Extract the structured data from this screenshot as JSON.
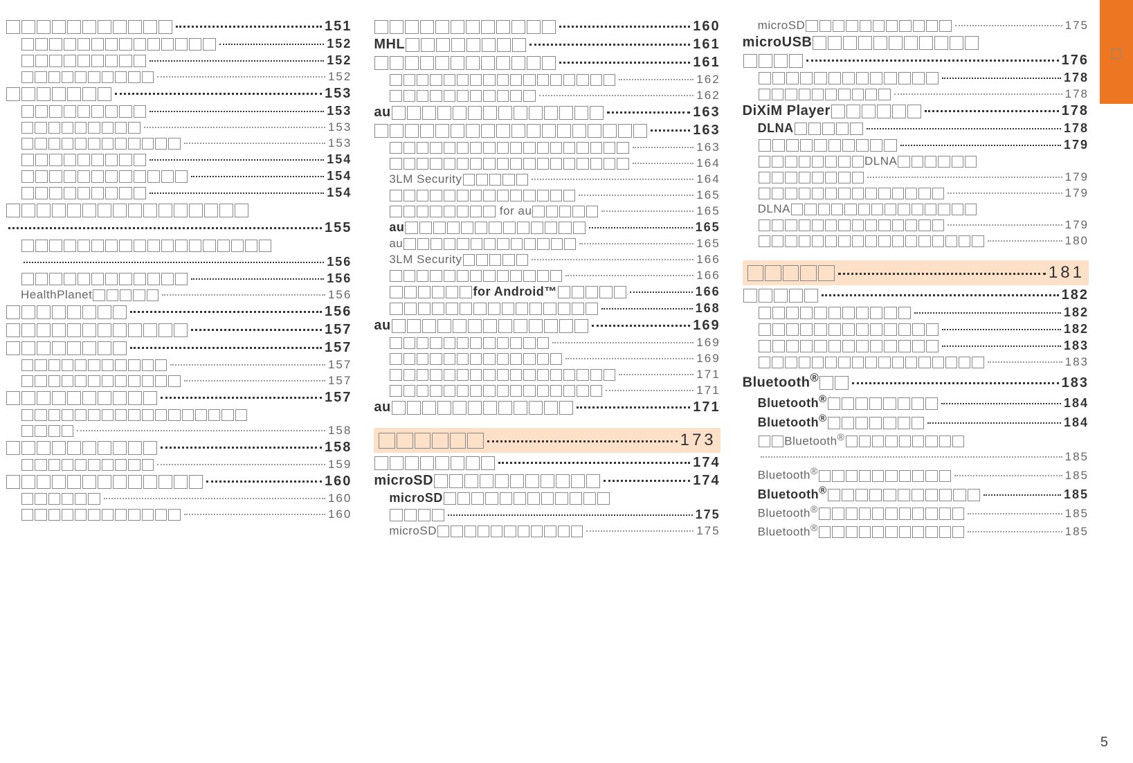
{
  "page_number": "5",
  "side_tab_text": "⬜",
  "columns": [
    [
      {
        "level": 0,
        "boxes": 11,
        "text": "",
        "page": "151"
      },
      {
        "level": 1,
        "boxes": 14,
        "text": "",
        "page": "152"
      },
      {
        "level": 1,
        "boxes": 9,
        "text": "",
        "page": "152"
      },
      {
        "level": 2,
        "boxes": 10,
        "text": "",
        "page": "152"
      },
      {
        "level": 0,
        "boxes": 7,
        "text": "",
        "page": "153"
      },
      {
        "level": 1,
        "boxes": 9,
        "text": "",
        "page": "153"
      },
      {
        "level": 2,
        "boxes": 9,
        "text": "",
        "page": "153"
      },
      {
        "level": 2,
        "boxes": 12,
        "text": "",
        "page": "153"
      },
      {
        "level": 1,
        "boxes": 9,
        "text": "",
        "page": "154"
      },
      {
        "level": 1,
        "boxes": 12,
        "text": "",
        "page": "154"
      },
      {
        "level": 1,
        "boxes": 9,
        "text": "",
        "page": "154"
      },
      {
        "level": 0,
        "nodots": true,
        "boxes": 16,
        "text": "",
        "page": ""
      },
      {
        "level": 0,
        "boxes": 0,
        "text": "",
        "page": "155",
        "prefix_dots_only": true
      },
      {
        "level": 1,
        "nodots": true,
        "boxes": 18,
        "text": "",
        "page": ""
      },
      {
        "level": 1,
        "boxes": 0,
        "text": "",
        "page": "156",
        "prefix_dots_only": true
      },
      {
        "level": 1,
        "boxes": 12,
        "text": "",
        "page": "156"
      },
      {
        "level": 2,
        "boxes": 0,
        "text": "HealthPlanet⬜⬜⬜⬜⬜",
        "page": "156"
      },
      {
        "level": 0,
        "boxes": 8,
        "text": "",
        "page": "156"
      },
      {
        "level": 0,
        "boxes": 12,
        "text": "",
        "page": "157"
      },
      {
        "level": 0,
        "boxes": 8,
        "text": "",
        "page": "157"
      },
      {
        "level": 2,
        "boxes": 11,
        "text": "",
        "page": "157"
      },
      {
        "level": 2,
        "boxes": 12,
        "text": "",
        "page": "157"
      },
      {
        "level": 0,
        "boxes": 10,
        "text": "",
        "page": "157"
      },
      {
        "level": 2,
        "nodots": true,
        "boxes": 17,
        "text": "",
        "page": ""
      },
      {
        "level": 2,
        "boxes": 4,
        "text": "",
        "page": "158"
      },
      {
        "level": 0,
        "boxes": 10,
        "text": "",
        "page": "158"
      },
      {
        "level": 2,
        "boxes": 10,
        "text": "",
        "page": "159"
      },
      {
        "level": 0,
        "boxes": 13,
        "text": "",
        "page": "160"
      },
      {
        "level": 2,
        "boxes": 6,
        "text": "",
        "page": "160"
      },
      {
        "level": 2,
        "boxes": 12,
        "text": "",
        "page": "160"
      }
    ],
    [
      {
        "level": 0,
        "boxes": 12,
        "text": "",
        "page": "160"
      },
      {
        "level": 0,
        "boxes": 0,
        "text": "MHL⬜⬜⬜⬜⬜⬜⬜⬜",
        "page": "161"
      },
      {
        "level": 0,
        "boxes": 12,
        "text": "",
        "page": "161"
      },
      {
        "level": 2,
        "boxes": 17,
        "text": "",
        "page": "162"
      },
      {
        "level": 2,
        "boxes": 11,
        "text": "",
        "page": "162"
      },
      {
        "level": 0,
        "boxes": 0,
        "text": "au⬜⬜⬜⬜⬜⬜⬜⬜⬜⬜⬜⬜⬜⬜",
        "page": "163"
      },
      {
        "level": 0,
        "boxes": 18,
        "text": "",
        "page": "163"
      },
      {
        "level": 2,
        "boxes": 18,
        "text": "",
        "page": "163"
      },
      {
        "level": 2,
        "boxes": 18,
        "text": "",
        "page": "164"
      },
      {
        "level": 2,
        "boxes": 0,
        "text": "3LM Security⬜⬜⬜⬜⬜",
        "page": "164"
      },
      {
        "level": 2,
        "boxes": 14,
        "text": "",
        "page": "165"
      },
      {
        "level": 2,
        "boxes": 0,
        "text": "⬜⬜⬜⬜⬜⬜⬜⬜ for au⬜⬜⬜⬜⬜",
        "page": "165"
      },
      {
        "level": 1,
        "boxes": 0,
        "text": "au⬜⬜⬜⬜⬜⬜⬜⬜⬜⬜⬜⬜⬜",
        "page": "165"
      },
      {
        "level": 2,
        "boxes": 0,
        "text": "au⬜⬜⬜⬜⬜⬜⬜⬜⬜⬜⬜⬜⬜",
        "page": "165"
      },
      {
        "level": 2,
        "boxes": 0,
        "text": "3LM Security⬜⬜⬜⬜⬜",
        "page": "166"
      },
      {
        "level": 2,
        "boxes": 13,
        "text": "",
        "page": "166"
      },
      {
        "level": 1,
        "boxes": 0,
        "text": "⬜⬜⬜⬜⬜⬜for Android™⬜⬜⬜⬜⬜",
        "page": "166"
      },
      {
        "level": 1,
        "boxes": 15,
        "text": "",
        "page": "168"
      },
      {
        "level": 0,
        "boxes": 0,
        "text": "au⬜⬜⬜⬜⬜⬜⬜⬜⬜⬜⬜⬜⬜",
        "page": "169"
      },
      {
        "level": 2,
        "boxes": 12,
        "text": "",
        "page": "169"
      },
      {
        "level": 2,
        "boxes": 13,
        "text": "",
        "page": "169"
      },
      {
        "level": 2,
        "boxes": 17,
        "text": "",
        "page": "171"
      },
      {
        "level": 2,
        "boxes": 16,
        "text": "",
        "page": "171"
      },
      {
        "level": 0,
        "boxes": 0,
        "text": "au⬜⬜⬜⬜⬜⬜⬜⬜⬜⬜⬜⬜",
        "page": "171"
      },
      {
        "section": true,
        "boxes": 6,
        "text": "",
        "page": "173"
      },
      {
        "level": 0,
        "boxes": 8,
        "text": "",
        "page": "174"
      },
      {
        "level": 0,
        "boxes": 0,
        "text": "microSD⬜⬜⬜⬜⬜⬜⬜⬜⬜⬜⬜",
        "page": "174"
      },
      {
        "level": 1,
        "nodots": true,
        "boxes": 0,
        "text": "microSD⬜⬜⬜⬜⬜⬜⬜⬜⬜⬜⬜⬜",
        "page": ""
      },
      {
        "level": 1,
        "boxes": 4,
        "text": "",
        "page": "175"
      },
      {
        "level": 2,
        "boxes": 0,
        "text": "microSD⬜⬜⬜⬜⬜⬜⬜⬜⬜⬜⬜",
        "page": "175"
      }
    ],
    [
      {
        "level": 2,
        "boxes": 0,
        "text": "microSD⬜⬜⬜⬜⬜⬜⬜⬜⬜⬜⬜",
        "page": "175"
      },
      {
        "level": 0,
        "nodots": true,
        "boxes": 0,
        "text": "microUSB⬜⬜⬜⬜⬜⬜⬜⬜⬜⬜⬜",
        "page": ""
      },
      {
        "level": 0,
        "boxes": 4,
        "text": "",
        "page": "176"
      },
      {
        "level": 1,
        "boxes": 13,
        "text": "",
        "page": "178"
      },
      {
        "level": 2,
        "boxes": 10,
        "text": "",
        "page": "178"
      },
      {
        "level": 0,
        "boxes": 0,
        "text": "DiXiM Player⬜⬜⬜⬜⬜⬜",
        "page": "178"
      },
      {
        "level": 1,
        "boxes": 0,
        "text": "DLNA⬜⬜⬜⬜⬜",
        "page": "178"
      },
      {
        "level": 1,
        "boxes": 10,
        "text": "",
        "page": "179"
      },
      {
        "level": 2,
        "nodots": true,
        "boxes": 0,
        "text": "⬜⬜⬜⬜⬜⬜⬜⬜DLNA⬜⬜⬜⬜⬜⬜",
        "page": ""
      },
      {
        "level": 2,
        "boxes": 8,
        "text": "",
        "page": "179"
      },
      {
        "level": 2,
        "boxes": 14,
        "text": "",
        "page": "179"
      },
      {
        "level": 2,
        "nodots": true,
        "boxes": 0,
        "text": "DLNA⬜⬜⬜⬜⬜⬜⬜⬜⬜⬜⬜⬜⬜⬜",
        "page": ""
      },
      {
        "level": 2,
        "boxes": 14,
        "text": "",
        "page": "179"
      },
      {
        "level": 2,
        "boxes": 17,
        "text": "",
        "page": "180"
      },
      {
        "section": true,
        "boxes": 5,
        "text": "",
        "page": "181"
      },
      {
        "level": 0,
        "boxes": 5,
        "text": "",
        "page": "182"
      },
      {
        "level": 1,
        "boxes": 11,
        "text": "",
        "page": "182"
      },
      {
        "level": 1,
        "boxes": 13,
        "text": "",
        "page": "182"
      },
      {
        "level": 1,
        "boxes": 13,
        "text": "",
        "page": "183"
      },
      {
        "level": 2,
        "boxes": 17,
        "text": "",
        "page": "183"
      },
      {
        "level": 0,
        "boxes": 0,
        "text": "Bluetooth<sup>®</sup>⬜⬜",
        "page": "183"
      },
      {
        "level": 1,
        "boxes": 0,
        "text": "Bluetooth<sup>®</sup>⬜⬜⬜⬜⬜⬜⬜⬜",
        "page": "184"
      },
      {
        "level": 1,
        "boxes": 0,
        "text": "Bluetooth<sup>®</sup>⬜⬜⬜⬜⬜⬜⬜",
        "page": "184"
      },
      {
        "level": 2,
        "nodots": true,
        "boxes": 0,
        "text": "⬜⬜Bluetooth<sup>®</sup>⬜⬜⬜⬜⬜⬜⬜⬜⬜",
        "page": ""
      },
      {
        "level": 2,
        "boxes": 0,
        "text": "",
        "page": "185",
        "prefix_dots_only": true
      },
      {
        "level": 2,
        "boxes": 0,
        "text": "Bluetooth<sup>®</sup>⬜⬜⬜⬜⬜⬜⬜⬜⬜⬜",
        "page": "185"
      },
      {
        "level": 1,
        "boxes": 0,
        "text": "Bluetooth<sup>®</sup>⬜⬜⬜⬜⬜⬜⬜⬜⬜⬜⬜",
        "page": "185"
      },
      {
        "level": 2,
        "boxes": 0,
        "text": "Bluetooth<sup>®</sup>⬜⬜⬜⬜⬜⬜⬜⬜⬜⬜⬜",
        "page": "185"
      },
      {
        "level": 2,
        "boxes": 0,
        "text": "Bluetooth<sup>®</sup>⬜⬜⬜⬜⬜⬜⬜⬜⬜⬜⬜",
        "page": "185"
      }
    ]
  ]
}
